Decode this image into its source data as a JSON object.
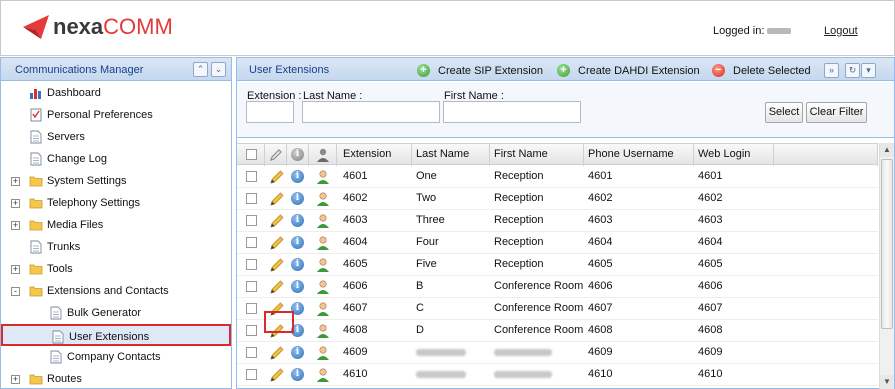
{
  "header": {
    "logo_part1": "nexa",
    "logo_part2": "COMM",
    "logged_in_label": "Logged in:",
    "logout_label": "Logout"
  },
  "nav": {
    "title": "Communications Manager",
    "items": [
      {
        "label": "Dashboard",
        "icon": "chart-icon",
        "level": 0,
        "expander": ""
      },
      {
        "label": "Personal Preferences",
        "icon": "checklist-icon",
        "level": 0,
        "expander": ""
      },
      {
        "label": "Servers",
        "icon": "page-icon",
        "level": 0,
        "expander": ""
      },
      {
        "label": "Change Log",
        "icon": "page-icon",
        "level": 0,
        "expander": ""
      },
      {
        "label": "System Settings",
        "icon": "folder-icon",
        "level": 0,
        "expander": "+"
      },
      {
        "label": "Telephony Settings",
        "icon": "folder-icon",
        "level": 0,
        "expander": "+"
      },
      {
        "label": "Media Files",
        "icon": "folder-icon",
        "level": 0,
        "expander": "+"
      },
      {
        "label": "Trunks",
        "icon": "page-icon",
        "level": 0,
        "expander": ""
      },
      {
        "label": "Tools",
        "icon": "folder-icon",
        "level": 0,
        "expander": "+"
      },
      {
        "label": "Extensions and Contacts",
        "icon": "folder-icon",
        "level": 0,
        "expander": "-"
      },
      {
        "label": "Bulk Generator",
        "icon": "page-icon",
        "level": 1,
        "expander": ""
      },
      {
        "label": "User Extensions",
        "icon": "page-icon",
        "level": 1,
        "expander": ""
      },
      {
        "label": "Company Contacts",
        "icon": "page-icon",
        "level": 1,
        "expander": ""
      },
      {
        "label": "Routes",
        "icon": "folder-icon",
        "level": 0,
        "expander": "+"
      }
    ]
  },
  "main": {
    "title": "User Extensions",
    "create_sip": "Create SIP Extension",
    "create_dahdi": "Create DAHDI Extension",
    "delete_selected": "Delete Selected",
    "filter": {
      "extension_label": "Extension :",
      "last_name_label": "Last Name :",
      "first_name_label": "First Name :",
      "select_button": "Select",
      "clear_button": "Clear Filter"
    },
    "columns": [
      "Extension",
      "Last Name",
      "First Name",
      "Phone Username",
      "Web Login"
    ],
    "rows": [
      {
        "extension": "4601",
        "last_name": "One",
        "first_name": "Reception",
        "phone_username": "4601",
        "web_login": "4601",
        "blurred": false
      },
      {
        "extension": "4602",
        "last_name": "Two",
        "first_name": "Reception",
        "phone_username": "4602",
        "web_login": "4602",
        "blurred": false
      },
      {
        "extension": "4603",
        "last_name": "Three",
        "first_name": "Reception",
        "phone_username": "4603",
        "web_login": "4603",
        "blurred": false
      },
      {
        "extension": "4604",
        "last_name": "Four",
        "first_name": "Reception",
        "phone_username": "4604",
        "web_login": "4604",
        "blurred": false
      },
      {
        "extension": "4605",
        "last_name": "Five",
        "first_name": "Reception",
        "phone_username": "4605",
        "web_login": "4605",
        "blurred": false
      },
      {
        "extension": "4606",
        "last_name": "B",
        "first_name": "Conference Room",
        "phone_username": "4606",
        "web_login": "4606",
        "blurred": false
      },
      {
        "extension": "4607",
        "last_name": "C",
        "first_name": "Conference Room",
        "phone_username": "4607",
        "web_login": "4607",
        "blurred": false
      },
      {
        "extension": "4608",
        "last_name": "D",
        "first_name": "Conference Room",
        "phone_username": "4608",
        "web_login": "4608",
        "blurred": false
      },
      {
        "extension": "4609",
        "last_name": "",
        "first_name": "",
        "phone_username": "4609",
        "web_login": "4609",
        "blurred": true
      },
      {
        "extension": "4610",
        "last_name": "",
        "first_name": "",
        "phone_username": "4610",
        "web_login": "4610",
        "blurred": true
      }
    ]
  },
  "colors": {
    "accent": "#15428b",
    "highlight_border": "#d92b2b",
    "logo_red": "#e53a3a"
  }
}
